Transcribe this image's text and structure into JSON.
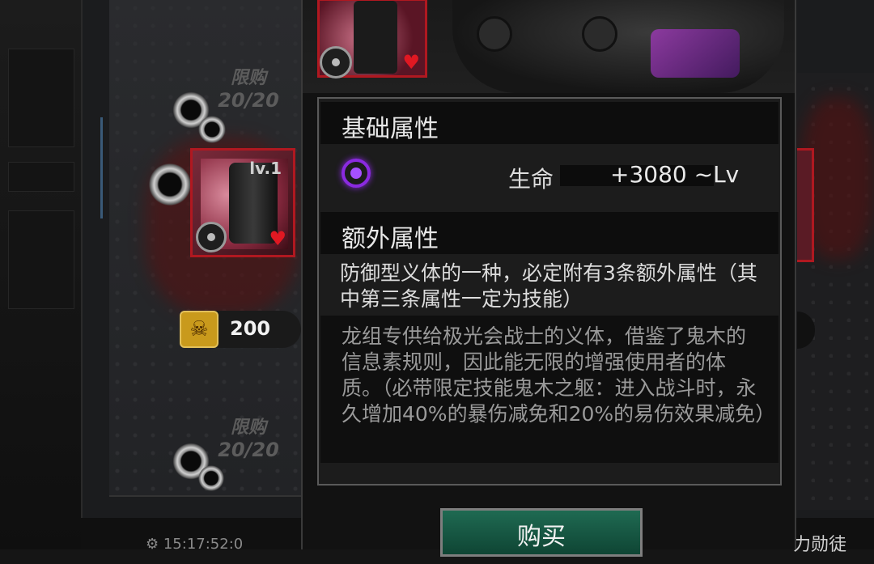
{
  "shop": {
    "limit_label_1": "限购",
    "limit_count_1": "20/20",
    "limit_label_2": "限购",
    "limit_count_2": "20/20",
    "item_level": "lv.1",
    "price": "200",
    "currency_icon": "skull-coin-icon"
  },
  "popup": {
    "base_section_title": "基础属性",
    "base_attr": {
      "icon": "purple-cybernetic-icon",
      "label": "生命",
      "value": "+3080 ~Lv"
    },
    "extra_section_title": "额外属性",
    "extra_desc": "防御型义体的一种，必定附有3条额外属性（其中第三条属性一定为技能）",
    "flavor_text": "龙组专供给极光会战士的义体，借鉴了鬼木的信息素规则，因此能无限的增强使用者的体质。（必带限定技能鬼木之躯：进入战斗时，永久增加40%的暴伤减免和20%的易伤效果减免）",
    "buy_button": "购买"
  },
  "bottom": {
    "left_text": "⚙ 15:17:52:0",
    "right_text": "力勋徒"
  },
  "colors": {
    "card_border": "#b01820",
    "buy_green": "#1f6a52",
    "attr_purple": "#8a2ae0",
    "coin_gold": "#c99a1c"
  }
}
